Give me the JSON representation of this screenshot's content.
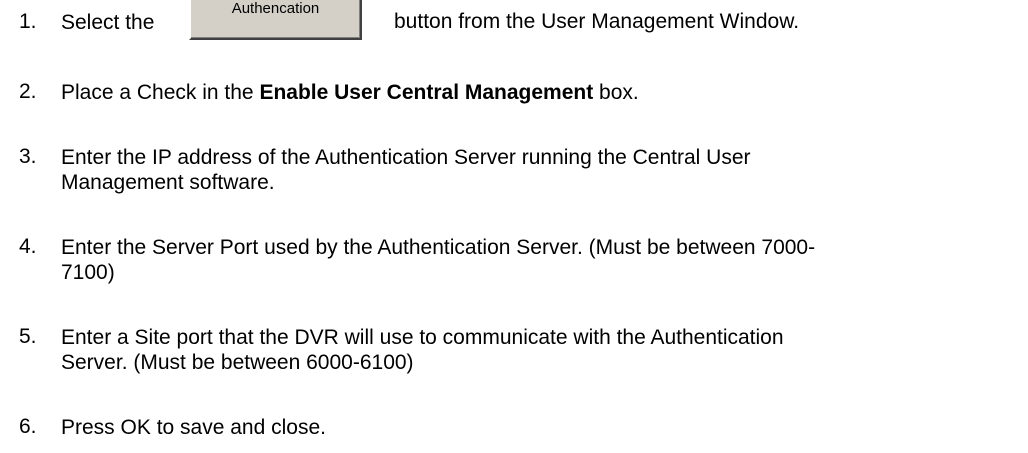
{
  "steps": [
    {
      "number": "1.",
      "before_button": "Select the",
      "button_label": "Authencation",
      "after_button": "button from the User Management Window."
    },
    {
      "number": "2.",
      "prefix": "Place a Check in the ",
      "bold": "Enable User Central Management",
      "suffix": " box."
    },
    {
      "number": "3.",
      "lines": [
        "Enter the IP address of the Authentication Server running the Central User",
        "Management software."
      ]
    },
    {
      "number": "4.",
      "lines": [
        "Enter the Server Port used by the Authentication Server. (Must be between 7000-",
        "7100)"
      ]
    },
    {
      "number": "5.",
      "lines": [
        "Enter a Site port that the DVR will use to communicate with the Authentication",
        "Server. (Must be between 6000-6100)"
      ]
    },
    {
      "number": "6.",
      "lines": [
        "Press OK to save and close."
      ]
    }
  ]
}
